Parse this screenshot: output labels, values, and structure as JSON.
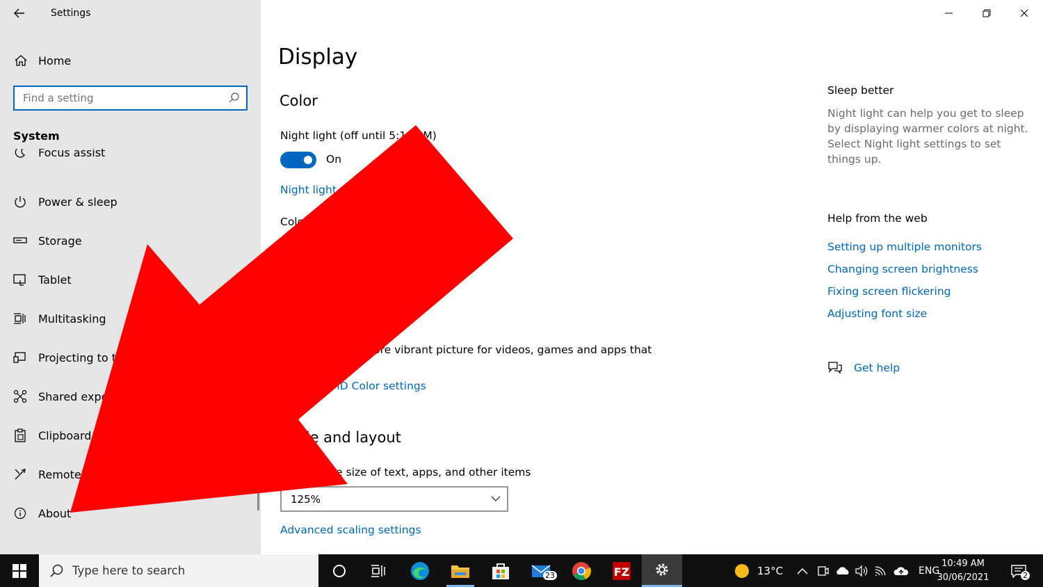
{
  "window": {
    "title": "Settings"
  },
  "sidebar": {
    "home_label": "Home",
    "search_placeholder": "Find a setting",
    "section_label": "System",
    "items": [
      {
        "label": "Focus assist",
        "icon": "moon-icon"
      },
      {
        "label": "Power & sleep",
        "icon": "power-icon"
      },
      {
        "label": "Storage",
        "icon": "storage-icon"
      },
      {
        "label": "Tablet",
        "icon": "tablet-icon"
      },
      {
        "label": "Multitasking",
        "icon": "multitasking-icon"
      },
      {
        "label": "Projecting to this PC",
        "icon": "projecting-icon"
      },
      {
        "label": "Shared experiences",
        "icon": "shared-icon"
      },
      {
        "label": "Clipboard",
        "icon": "clipboard-icon"
      },
      {
        "label": "Remote Desktop",
        "icon": "remote-icon"
      },
      {
        "label": "About",
        "icon": "info-icon"
      }
    ]
  },
  "main": {
    "title": "Display",
    "color_heading": "Color",
    "night_light_label": "Night light (off until 5:10 PM)",
    "toggle_state": "On",
    "night_light_settings_link": "Night light settings",
    "color_profile_label": "Color profile",
    "hdr_text": "Get a brighter, more vibrant picture for videos, games and apps that",
    "hdr_link": "Windows HD Color settings",
    "scale_heading": "Scale and layout",
    "scale_label": "Change the size of text, apps, and other items",
    "scale_value": "125%",
    "advanced_link": "Advanced scaling settings"
  },
  "side_panel": {
    "sleep_heading": "Sleep better",
    "sleep_text": "Night light can help you get to sleep by displaying warmer colors at night. Select Night light settings to set things up.",
    "help_heading": "Help from the web",
    "help_links": [
      "Setting up multiple monitors",
      "Changing screen brightness",
      "Fixing screen flickering",
      "Adjusting font size"
    ],
    "get_help": "Get help"
  },
  "taskbar": {
    "search_placeholder": "Type here to search",
    "mail_badge": "23",
    "weather": "13°C",
    "language": "ENG",
    "time": "10:49 AM",
    "date": "30/06/2021",
    "notification_count": "2"
  },
  "colors": {
    "accent": "#0067c0",
    "link": "#0067b8",
    "arrow": "#ff0000"
  }
}
